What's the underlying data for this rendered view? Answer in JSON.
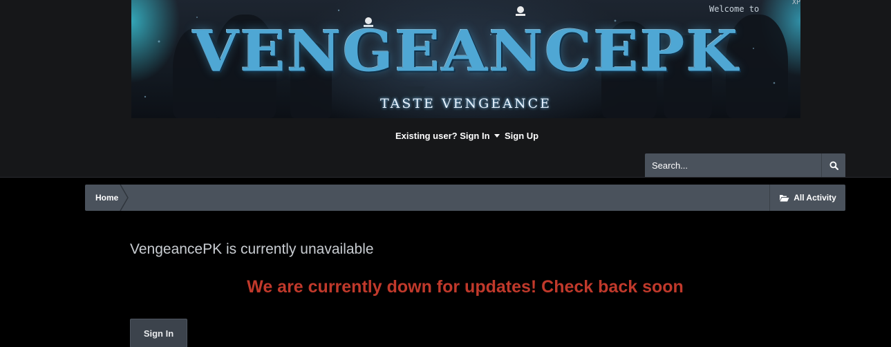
{
  "banner": {
    "logo_text": "VENGEANCEPK",
    "tagline": "TASTE VENGEANCE",
    "overlay_welcome": "Welcome to",
    "overlay_xp": "XP"
  },
  "user_nav": {
    "sign_in_label": "Existing user? Sign In",
    "sign_up_label": "Sign Up"
  },
  "search": {
    "placeholder": "Search...",
    "icon": "search-icon"
  },
  "breadcrumb": {
    "home_label": "Home",
    "all_activity_label": "All Activity",
    "all_activity_icon": "folder-open-icon"
  },
  "main": {
    "title": "VengeancePK is currently unavailable",
    "message": "We are currently down for updates! Check back soon",
    "sign_in_button": "Sign In"
  },
  "colors": {
    "page_background": "#000000",
    "header_background": "#161719",
    "bar_background": "#4a525c",
    "message_red": "#c0392b",
    "banner_glow": "#4fa7d4"
  }
}
